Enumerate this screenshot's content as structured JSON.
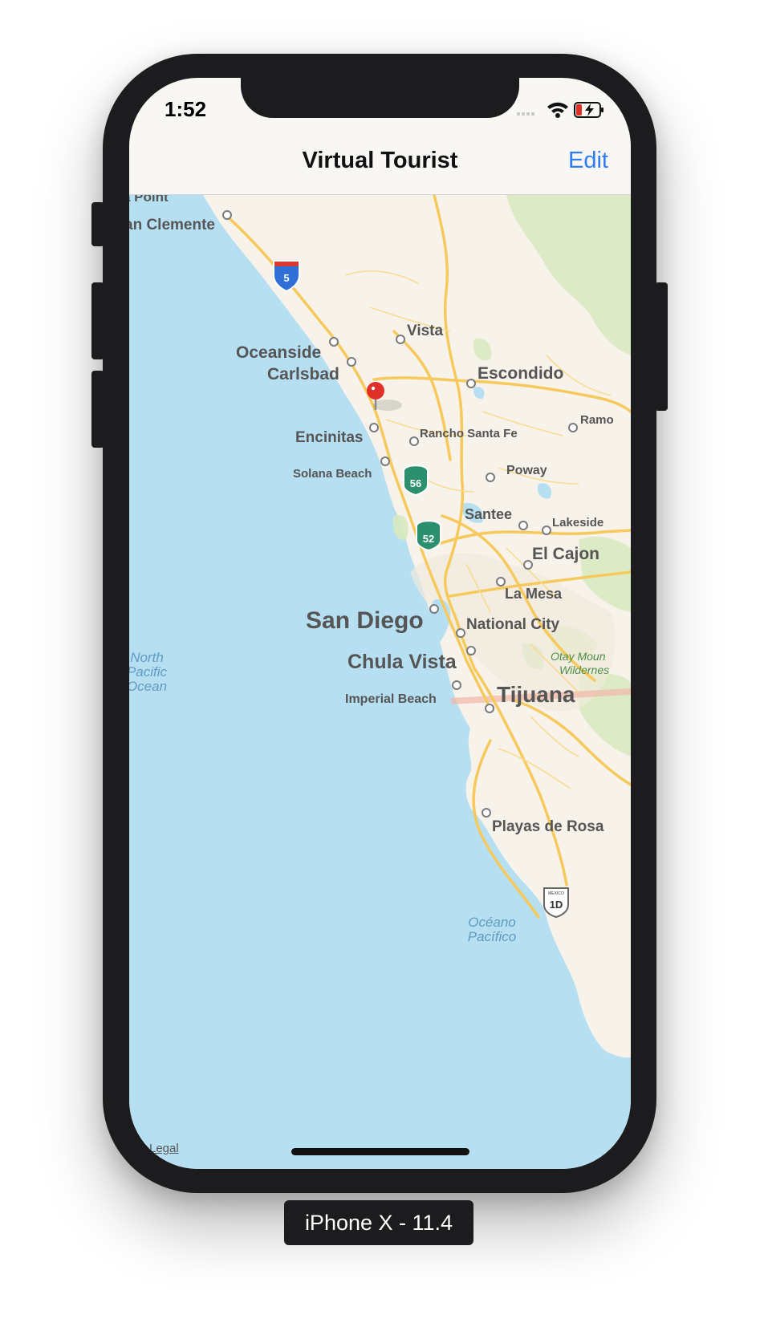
{
  "status_bar": {
    "time": "1:52"
  },
  "nav": {
    "title": "Virtual Tourist",
    "edit_label": "Edit"
  },
  "map": {
    "legal": "Legal",
    "places": {
      "point": "a Point",
      "san_clemente": "an Clemente",
      "vista": "Vista",
      "oceanside": "Oceanside",
      "carlsbad": "Carlsbad",
      "escondido": "Escondido",
      "ramona": "Ramo",
      "rancho_santa_fe": "Rancho Santa Fe",
      "encinitas": "Encinitas",
      "solana_beach": "Solana Beach",
      "poway": "Poway",
      "santee": "Santee",
      "lakeside": "Lakeside",
      "el_cajon": "El Cajon",
      "la_mesa": "La Mesa",
      "san_diego": "San Diego",
      "national_city": "National City",
      "chula_vista": "Chula Vista",
      "imperial_beach": "Imperial Beach",
      "tijuana": "Tijuana",
      "playas": "Playas de Rosa"
    },
    "water": {
      "north_pacific_1": "North",
      "north_pacific_2": "Pacific",
      "north_pacific_3": "Ocean",
      "oceano_1": "Océano",
      "oceano_2": "Pacífico"
    },
    "parks": {
      "otay_1": "Otay Moun",
      "otay_2": "Wildernes"
    },
    "shields": {
      "i5": "5",
      "sr56": "56",
      "sr52": "52",
      "mex1d": "1D",
      "mex_label": "MEXICO"
    }
  },
  "device_label": "iPhone X - 11.4",
  "colors": {
    "ocean": "#b7dff2",
    "land": "#f7f3ea",
    "road": "#f6cb62",
    "park": "#cfe6b8",
    "pin": "#e0302a",
    "accent": "#2f7cf6"
  }
}
